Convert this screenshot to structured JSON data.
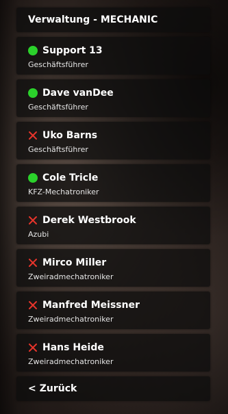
{
  "menu": {
    "title": "Verwaltung - MECHANIC",
    "back_chevron": "<",
    "back_label": "Zurück",
    "status_colors": {
      "online": "#2bd12b",
      "offline": "#e8342b"
    },
    "entries": [
      {
        "name": "Support 13",
        "role": "Geschäftsführer",
        "status": "online"
      },
      {
        "name": "Dave vanDee",
        "role": "Geschäftsführer",
        "status": "online"
      },
      {
        "name": "Uko Barns",
        "role": "Geschäftsführer",
        "status": "offline"
      },
      {
        "name": "Cole Tricle",
        "role": "KFZ-Mechatroniker",
        "status": "online"
      },
      {
        "name": "Derek Westbrook",
        "role": "Azubi",
        "status": "offline"
      },
      {
        "name": "Mirco Miller",
        "role": "Zweiradmechatroniker",
        "status": "offline"
      },
      {
        "name": "Manfred Meissner",
        "role": "Zweiradmechatroniker",
        "status": "offline"
      },
      {
        "name": "Hans Heide",
        "role": "Zweiradmechatroniker",
        "status": "offline"
      }
    ]
  }
}
